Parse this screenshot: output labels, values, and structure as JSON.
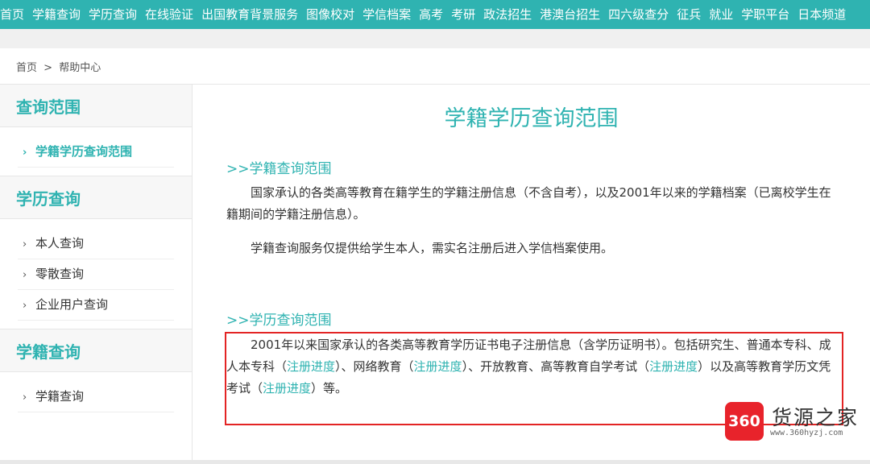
{
  "topnav": {
    "items": [
      "首页",
      "学籍查询",
      "学历查询",
      "在线验证",
      "出国教育背景服务",
      "图像校对",
      "学信档案",
      "高考",
      "考研",
      "政法招生",
      "港澳台招生",
      "四六级查分",
      "征兵",
      "就业",
      "学职平台",
      "日本频道"
    ]
  },
  "breadcrumb": {
    "home": "首页",
    "separator": ">",
    "current": "帮助中心"
  },
  "sidebar": {
    "sections": [
      {
        "title": "查询范围",
        "items": [
          "学籍学历查询范围"
        ]
      },
      {
        "title": "学历查询",
        "items": [
          "本人查询",
          "零散查询",
          "企业用户查询"
        ]
      },
      {
        "title": "学籍查询",
        "items": [
          "学籍查询"
        ]
      }
    ],
    "chevron": "›"
  },
  "main": {
    "title": "学籍学历查询范围",
    "section1": {
      "title": ">>学籍查询范围",
      "p1": "国家承认的各类高等教育在籍学生的学籍注册信息（不含自考），以及2001年以来的学籍档案（已离校学生在籍期间的学籍注册信息）。",
      "p2": "学籍查询服务仅提供给学生本人，需实名注册后进入学信档案使用。"
    },
    "section2": {
      "title": ">>学历查询范围",
      "p_a": "2001年以来国家承认的各类高等教育学历证书电子注册信息（含学历证明书）。包括研究生、普通本专科、成人本专科（",
      "link1": "注册进度",
      "p_b": "）、网络教育（",
      "link2": "注册进度",
      "p_c": "）、开放教育、高等教育自学考试（",
      "link3": "注册进度",
      "p_d": "）以及高等教育学历文凭考试（",
      "link4": "注册进度",
      "p_e": "）等。"
    }
  },
  "watermark": {
    "logo": "360",
    "name": "货源之家",
    "url": "www.360hyzj.com"
  },
  "colors": {
    "accent": "#2fb3b1",
    "highlight_box": "#e32424"
  }
}
